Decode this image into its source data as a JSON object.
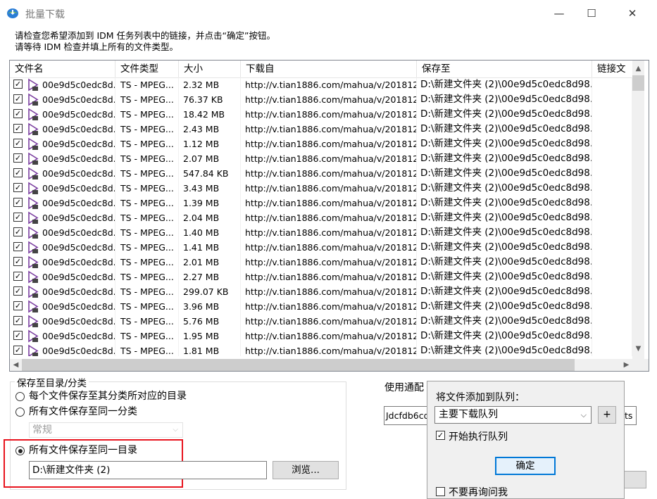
{
  "window": {
    "title": "批量下载",
    "minimize_glyph": "—",
    "maximize_glyph": "☐",
    "close_glyph": "✕"
  },
  "instructions": {
    "line1": "请检查您希望添加到 IDM 任务列表中的链接，并点击“确定”按钮。",
    "line2": "请等待 IDM 检查并填上所有的文件类型。"
  },
  "list": {
    "columns": [
      "文件名",
      "文件类型",
      "大小",
      "下载自",
      "保存至",
      "链接文"
    ],
    "rows": [
      {
        "checked": true,
        "name": "00e9d5c0edc8d...",
        "type": "TS - MPEG...",
        "size": "2.32  MB",
        "url": "http://v.tian1886.com/mahua/v/201812...",
        "save": "D:\\新建文件夹 (2)\\00e9d5c0edc8d98..."
      },
      {
        "checked": true,
        "name": "00e9d5c0edc8d...",
        "type": "TS - MPEG...",
        "size": "76.37  KB",
        "url": "http://v.tian1886.com/mahua/v/201812...",
        "save": "D:\\新建文件夹 (2)\\00e9d5c0edc8d98..."
      },
      {
        "checked": true,
        "name": "00e9d5c0edc8d...",
        "type": "TS - MPEG...",
        "size": "18.42  MB",
        "url": "http://v.tian1886.com/mahua/v/201812...",
        "save": "D:\\新建文件夹 (2)\\00e9d5c0edc8d98..."
      },
      {
        "checked": true,
        "name": "00e9d5c0edc8d...",
        "type": "TS - MPEG...",
        "size": "2.43  MB",
        "url": "http://v.tian1886.com/mahua/v/201812...",
        "save": "D:\\新建文件夹 (2)\\00e9d5c0edc8d98..."
      },
      {
        "checked": true,
        "name": "00e9d5c0edc8d...",
        "type": "TS - MPEG...",
        "size": "1.12  MB",
        "url": "http://v.tian1886.com/mahua/v/201812...",
        "save": "D:\\新建文件夹 (2)\\00e9d5c0edc8d98..."
      },
      {
        "checked": true,
        "name": "00e9d5c0edc8d...",
        "type": "TS - MPEG...",
        "size": "2.07  MB",
        "url": "http://v.tian1886.com/mahua/v/201812...",
        "save": "D:\\新建文件夹 (2)\\00e9d5c0edc8d98..."
      },
      {
        "checked": true,
        "name": "00e9d5c0edc8d...",
        "type": "TS - MPEG...",
        "size": "547.84  KB",
        "url": "http://v.tian1886.com/mahua/v/201812...",
        "save": "D:\\新建文件夹 (2)\\00e9d5c0edc8d98..."
      },
      {
        "checked": true,
        "name": "00e9d5c0edc8d...",
        "type": "TS - MPEG...",
        "size": "3.43  MB",
        "url": "http://v.tian1886.com/mahua/v/201812...",
        "save": "D:\\新建文件夹 (2)\\00e9d5c0edc8d98..."
      },
      {
        "checked": true,
        "name": "00e9d5c0edc8d...",
        "type": "TS - MPEG...",
        "size": "1.39  MB",
        "url": "http://v.tian1886.com/mahua/v/201812...",
        "save": "D:\\新建文件夹 (2)\\00e9d5c0edc8d98..."
      },
      {
        "checked": true,
        "name": "00e9d5c0edc8d...",
        "type": "TS - MPEG...",
        "size": "2.04  MB",
        "url": "http://v.tian1886.com/mahua/v/201812...",
        "save": "D:\\新建文件夹 (2)\\00e9d5c0edc8d98..."
      },
      {
        "checked": true,
        "name": "00e9d5c0edc8d...",
        "type": "TS - MPEG...",
        "size": "1.40  MB",
        "url": "http://v.tian1886.com/mahua/v/201812...",
        "save": "D:\\新建文件夹 (2)\\00e9d5c0edc8d98..."
      },
      {
        "checked": true,
        "name": "00e9d5c0edc8d...",
        "type": "TS - MPEG...",
        "size": "1.41  MB",
        "url": "http://v.tian1886.com/mahua/v/201812...",
        "save": "D:\\新建文件夹 (2)\\00e9d5c0edc8d98..."
      },
      {
        "checked": true,
        "name": "00e9d5c0edc8d...",
        "type": "TS - MPEG...",
        "size": "2.01  MB",
        "url": "http://v.tian1886.com/mahua/v/201812...",
        "save": "D:\\新建文件夹 (2)\\00e9d5c0edc8d98..."
      },
      {
        "checked": true,
        "name": "00e9d5c0edc8d...",
        "type": "TS - MPEG...",
        "size": "2.27  MB",
        "url": "http://v.tian1886.com/mahua/v/201812...",
        "save": "D:\\新建文件夹 (2)\\00e9d5c0edc8d98..."
      },
      {
        "checked": true,
        "name": "00e9d5c0edc8d...",
        "type": "TS - MPEG...",
        "size": "299.07  KB",
        "url": "http://v.tian1886.com/mahua/v/201812...",
        "save": "D:\\新建文件夹 (2)\\00e9d5c0edc8d98..."
      },
      {
        "checked": true,
        "name": "00e9d5c0edc8d...",
        "type": "TS - MPEG...",
        "size": "3.96  MB",
        "url": "http://v.tian1886.com/mahua/v/201812...",
        "save": "D:\\新建文件夹 (2)\\00e9d5c0edc8d98..."
      },
      {
        "checked": true,
        "name": "00e9d5c0edc8d...",
        "type": "TS - MPEG...",
        "size": "5.76  MB",
        "url": "http://v.tian1886.com/mahua/v/201812...",
        "save": "D:\\新建文件夹 (2)\\00e9d5c0edc8d98..."
      },
      {
        "checked": true,
        "name": "00e9d5c0edc8d...",
        "type": "TS - MPEG...",
        "size": "1.95  MB",
        "url": "http://v.tian1886.com/mahua/v/201812...",
        "save": "D:\\新建文件夹 (2)\\00e9d5c0edc8d98..."
      },
      {
        "checked": true,
        "name": "00e9d5c0edc8d...",
        "type": "TS - MPEG...",
        "size": "1.81  MB",
        "url": "http://v.tian1886.com/mahua/v/201812...",
        "save": "D:\\新建文件夹 (2)\\00e9d5c0edc8d98..."
      }
    ]
  },
  "save_group": {
    "legend": "保存至目录/分类",
    "option1": "每个文件保存至其分类所对应的目录",
    "option2": "所有文件保存至同一分类",
    "category_value": "常规",
    "option3": "所有文件保存至同一目录",
    "path_value": "D:\\新建文件夹 (2)",
    "browse_label": "浏览...",
    "selected_option": 3
  },
  "background": {
    "label_partial": "使用通配",
    "input_partial": "Jdcfdb6cd",
    "input2_partial": "ts"
  },
  "queue_popup": {
    "label": "将文件添加到队列：",
    "queue_value": "主要下载队列",
    "plus_label": "+",
    "start_queue_label": "开始执行队列",
    "start_queue_checked": true,
    "ok_label": "确定",
    "dont_ask_label": "不要再询问我",
    "dont_ask_checked": false
  },
  "icons": {
    "check": "✓",
    "arrow_up": "▲",
    "arrow_down": "▼",
    "arrow_left": "◀",
    "arrow_right": "▶",
    "dropdown": "⌵"
  },
  "colors": {
    "highlight_red": "#e8141e",
    "focus_blue": "#0078d7",
    "file_icon_purple": "#7b3fa0"
  }
}
